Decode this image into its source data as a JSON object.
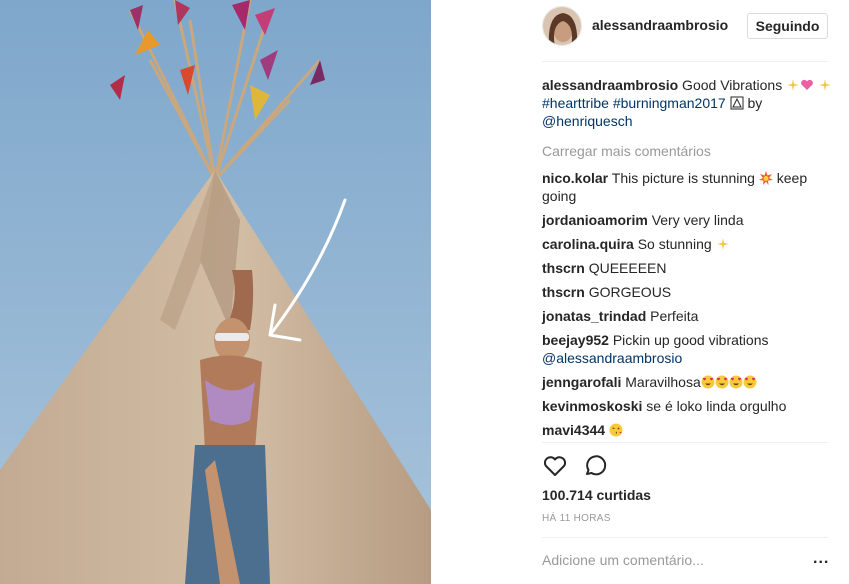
{
  "post": {
    "username": "alessandraambrosio",
    "follow_label": "Seguindo",
    "caption": {
      "user": "alessandraambrosio",
      "text1": " Good Vibrations ",
      "hashtags": "#hearttribe #burningman2017",
      "text2": " by ",
      "mention": "@henriquesch"
    },
    "load_more": "Carregar mais comentários",
    "comments": [
      {
        "user": "nico.kolar",
        "text": "This picture is stunning ",
        "text_after": " keep going"
      },
      {
        "user": "jordanioamorim",
        "text": "Very very linda"
      },
      {
        "user": "carolina.quira",
        "text": "So stunning "
      },
      {
        "user": "thscrn",
        "text": "QUEEEEEN"
      },
      {
        "user": "thscrn",
        "text": "GORGEOUS"
      },
      {
        "user": "jonatas_trindad",
        "text": "Perfeita"
      },
      {
        "user": "beejay952",
        "text": "Pickin up good vibrations ",
        "mention": "@alessandraambrosio"
      },
      {
        "user": "jenngarofali",
        "text": "Maravilhosa"
      },
      {
        "user": "kevinmoskoski",
        "text": "se é loko linda orgulho"
      },
      {
        "user": "mavi4344",
        "text": ""
      }
    ],
    "likes": "100.714 curtidas",
    "time": "HÁ 11 HORAS",
    "add_comment_placeholder": "Adicione um comentário...",
    "more_label": "..."
  },
  "icons": {
    "heart": "heart-icon",
    "comment": "comment-icon",
    "sparkles": "sparkles-emoji",
    "sparkling_heart": "sparkling-heart-emoji",
    "collision": "collision-emoji",
    "heart_eyes": "heart-eyes-emoji",
    "kiss": "kissing-heart-emoji",
    "arrow": "arrow-drawing"
  },
  "colors": {
    "sky": "#8fb3d4",
    "tent": "#c7b199",
    "link": "#003569",
    "muted": "#999999"
  }
}
